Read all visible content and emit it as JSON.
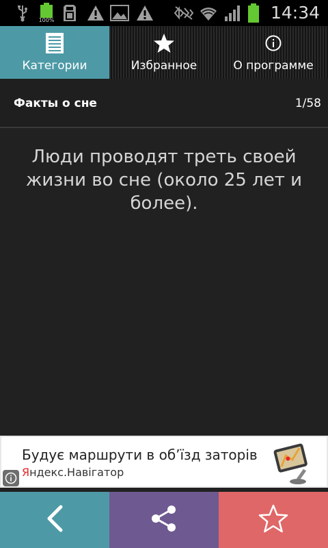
{
  "status_bar": {
    "time": "14:34",
    "battery_label": "100%",
    "icons": [
      "usb-icon",
      "battery-100-icon",
      "sd-card-icon",
      "warning-icon",
      "image-icon",
      "warning-icon",
      "silent-icon",
      "wifi-icon",
      "signal-icon",
      "battery-icon"
    ]
  },
  "tabs": [
    {
      "label": "Категории",
      "icon": "list-icon",
      "active": true
    },
    {
      "label": "Избранное",
      "icon": "star-icon",
      "active": false
    },
    {
      "label": "О программе",
      "icon": "info-icon",
      "active": false
    }
  ],
  "header": {
    "category_title": "Факты о сне",
    "counter": "1/58"
  },
  "fact": {
    "text": "Люди проводят треть своей жизни во сне (около 25 лет и более)."
  },
  "ad": {
    "headline": "Будує маршрути в об’їзд заторів",
    "brand_prefix": "Я",
    "brand_rest": "ндекс.Навігатор"
  },
  "bottom_bar": {
    "buttons": [
      {
        "name": "back",
        "icon": "chevron-left-icon",
        "color": "#4d9aa6"
      },
      {
        "name": "share",
        "icon": "share-icon",
        "color": "#6e5a91"
      },
      {
        "name": "favorite",
        "icon": "star-outline-icon",
        "color": "#e06767"
      }
    ]
  },
  "colors": {
    "accent_teal": "#4d9aa6",
    "share_purple": "#6e5a91",
    "favorite_red": "#e06767",
    "background": "#212121",
    "battery_green": "#64c832"
  }
}
